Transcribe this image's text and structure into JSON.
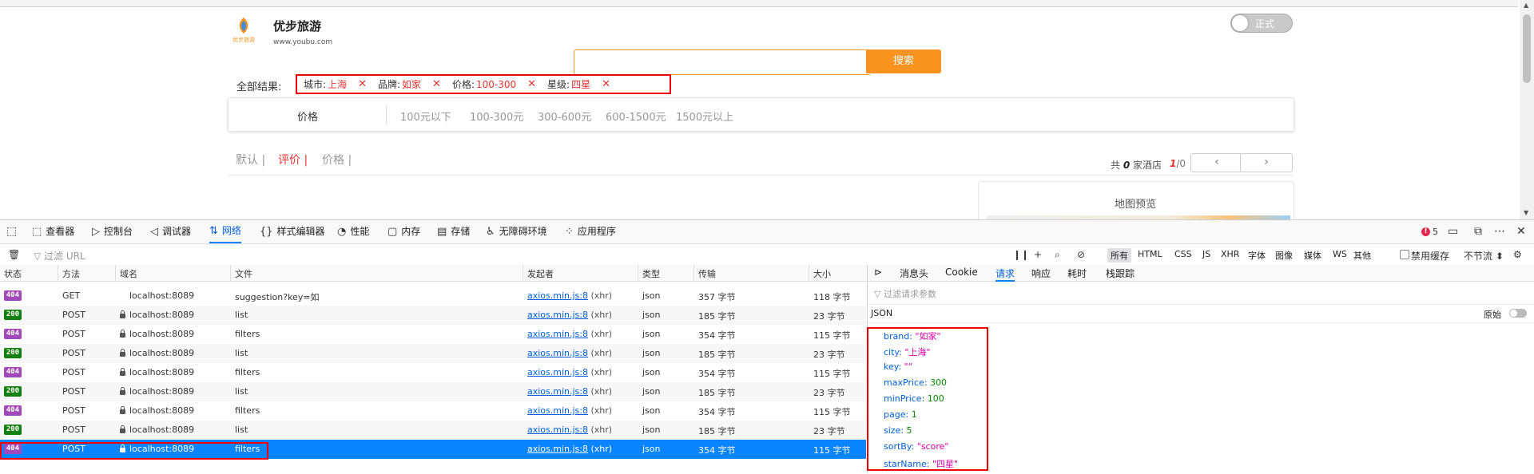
{
  "site": {
    "brand_name": "优步旅游",
    "brand_url": "www.youbu.com",
    "logo_text": "优步旅游",
    "toggle_label": "正式",
    "search_value": "",
    "search_button": "搜索",
    "all_results_label": "全部结果:",
    "chips": [
      {
        "key": "城市:",
        "value": "上海"
      },
      {
        "key": "品牌:",
        "value": "如家"
      },
      {
        "key": "价格:",
        "value": "100-300"
      },
      {
        "key": "星级:",
        "value": "四星"
      }
    ],
    "chip_remove": "✕",
    "price_label": "价格",
    "price_options": [
      "100元以下",
      "100-300元",
      "300-600元",
      "600-1500元",
      "1500元以上"
    ],
    "sort_tabs": [
      "默认 |",
      "评价 |",
      "价格 |"
    ],
    "count_prefix": "共",
    "count_value": "0",
    "count_suffix": "家酒店",
    "page_current": "1",
    "page_total": "/0",
    "prev": "‹",
    "next": "›",
    "map_title": "地图预览"
  },
  "devtools": {
    "tabs": [
      {
        "icon": "⬚",
        "label": "查看器"
      },
      {
        "icon": "▷",
        "label": "控制台"
      },
      {
        "icon": "◁",
        "label": "调试器"
      },
      {
        "icon": "⇅",
        "label": "网络"
      },
      {
        "icon": "{}",
        "label": "样式编辑器"
      },
      {
        "icon": "◔",
        "label": "性能"
      },
      {
        "icon": "▢",
        "label": "内存"
      },
      {
        "icon": "▤",
        "label": "存储"
      },
      {
        "icon": "♿",
        "label": "无障碍环境"
      },
      {
        "icon": "⁘",
        "label": "应用程序"
      }
    ],
    "error_count": "5",
    "filter_placeholder": "过滤 URL",
    "type_filters": [
      "所有",
      "HTML",
      "CSS",
      "JS",
      "XHR",
      "字体",
      "图像",
      "媒体",
      "WS",
      "其他"
    ],
    "disable_cache": "禁用缓存",
    "throttle": "不节流 ⬍",
    "columns": [
      "状态",
      "方法",
      "域名",
      "文件",
      "发起者",
      "类型",
      "传输",
      "大小"
    ],
    "requests": [
      {
        "status": "404",
        "method": "GET",
        "domain": "localhost:8089",
        "secure": false,
        "file": "suggestion?key=如",
        "initiator": "axios.min.js:8",
        "initiator_suffix": "(xhr)",
        "type": "json",
        "transfer": "357 字节",
        "size": "118 字节"
      },
      {
        "status": "200",
        "method": "POST",
        "domain": "localhost:8089",
        "secure": true,
        "file": "list",
        "initiator": "axios.min.js:8",
        "initiator_suffix": "(xhr)",
        "type": "json",
        "transfer": "185 字节",
        "size": "23 字节"
      },
      {
        "status": "404",
        "method": "POST",
        "domain": "localhost:8089",
        "secure": true,
        "file": "filters",
        "initiator": "axios.min.js:8",
        "initiator_suffix": "(xhr)",
        "type": "json",
        "transfer": "354 字节",
        "size": "115 字节"
      },
      {
        "status": "200",
        "method": "POST",
        "domain": "localhost:8089",
        "secure": true,
        "file": "list",
        "initiator": "axios.min.js:8",
        "initiator_suffix": "(xhr)",
        "type": "json",
        "transfer": "185 字节",
        "size": "23 字节"
      },
      {
        "status": "404",
        "method": "POST",
        "domain": "localhost:8089",
        "secure": true,
        "file": "filters",
        "initiator": "axios.min.js:8",
        "initiator_suffix": "(xhr)",
        "type": "json",
        "transfer": "354 字节",
        "size": "115 字节"
      },
      {
        "status": "200",
        "method": "POST",
        "domain": "localhost:8089",
        "secure": true,
        "file": "list",
        "initiator": "axios.min.js:8",
        "initiator_suffix": "(xhr)",
        "type": "json",
        "transfer": "185 字节",
        "size": "23 字节"
      },
      {
        "status": "404",
        "method": "POST",
        "domain": "localhost:8089",
        "secure": true,
        "file": "filters",
        "initiator": "axios.min.js:8",
        "initiator_suffix": "(xhr)",
        "type": "json",
        "transfer": "354 字节",
        "size": "115 字节"
      },
      {
        "status": "200",
        "method": "POST",
        "domain": "localhost:8089",
        "secure": true,
        "file": "list",
        "initiator": "axios.min.js:8",
        "initiator_suffix": "(xhr)",
        "type": "json",
        "transfer": "185 字节",
        "size": "23 字节"
      },
      {
        "status": "404",
        "method": "POST",
        "domain": "localhost:8089",
        "secure": true,
        "file": "filters",
        "initiator": "axios.min.js:8",
        "initiator_suffix": "(xhr)",
        "type": "json",
        "transfer": "354 字节",
        "size": "115 字节",
        "selected": true
      }
    ],
    "side_tabs": [
      "消息头",
      "Cookie",
      "请求",
      "响应",
      "耗时",
      "栈跟踪"
    ],
    "side_selected_tab": "请求",
    "param_filter_placeholder": "过滤请求参数",
    "json_label": "JSON",
    "raw_label": "原始",
    "payload": [
      {
        "key": "brand",
        "value": "\"如家\"",
        "kind": "str"
      },
      {
        "key": "city",
        "value": "\"上海\"",
        "kind": "str"
      },
      {
        "key": "key",
        "value": "\"\"",
        "kind": "str"
      },
      {
        "key": "maxPrice",
        "value": "300",
        "kind": "num"
      },
      {
        "key": "minPrice",
        "value": "100",
        "kind": "num"
      },
      {
        "key": "page",
        "value": "1",
        "kind": "num"
      },
      {
        "key": "size",
        "value": "5",
        "kind": "num"
      },
      {
        "key": "sortBy",
        "value": "\"score\"",
        "kind": "str"
      },
      {
        "key": "starName",
        "value": "\"四星\"",
        "kind": "str"
      }
    ]
  }
}
